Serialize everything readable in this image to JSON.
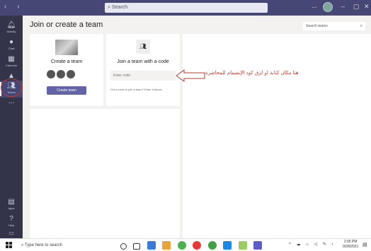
{
  "titlebar": {
    "search_placeholder": "Search",
    "more_label": "...",
    "colors": {
      "bar": "#464775"
    }
  },
  "rail": {
    "items": [
      {
        "label": "Activity",
        "icon": "bell-icon"
      },
      {
        "label": "Chat",
        "icon": "chat-icon"
      },
      {
        "label": "Calendar",
        "icon": "calendar-icon"
      },
      {
        "label": "Assignments",
        "icon": "assignments-icon"
      },
      {
        "label": "Teams",
        "icon": "teams-icon",
        "active": true
      },
      {
        "label": "...",
        "icon": "more-icon"
      }
    ],
    "bottom_items": [
      {
        "label": "Apps",
        "icon": "apps-icon"
      },
      {
        "label": "Help",
        "icon": "help-icon"
      }
    ]
  },
  "main": {
    "title": "Join or create a team",
    "search_teams_placeholder": "Search teams",
    "create_card": {
      "title": "Create a team",
      "button_label": "Create team"
    },
    "join_card": {
      "title": "Join a team with a code",
      "input_placeholder": "Enter code",
      "hint": "Got a code to join a team? Enter it above"
    },
    "annotation": "هنا مكان كتابة او لزق كود الإنضمام للمحاضرة",
    "colors": {
      "accent": "#6264a7",
      "annotation": "#c0392b"
    }
  },
  "taskbar": {
    "search_placeholder": "Type here to search",
    "time": "2:05 PM",
    "date": "9/28/2021"
  }
}
